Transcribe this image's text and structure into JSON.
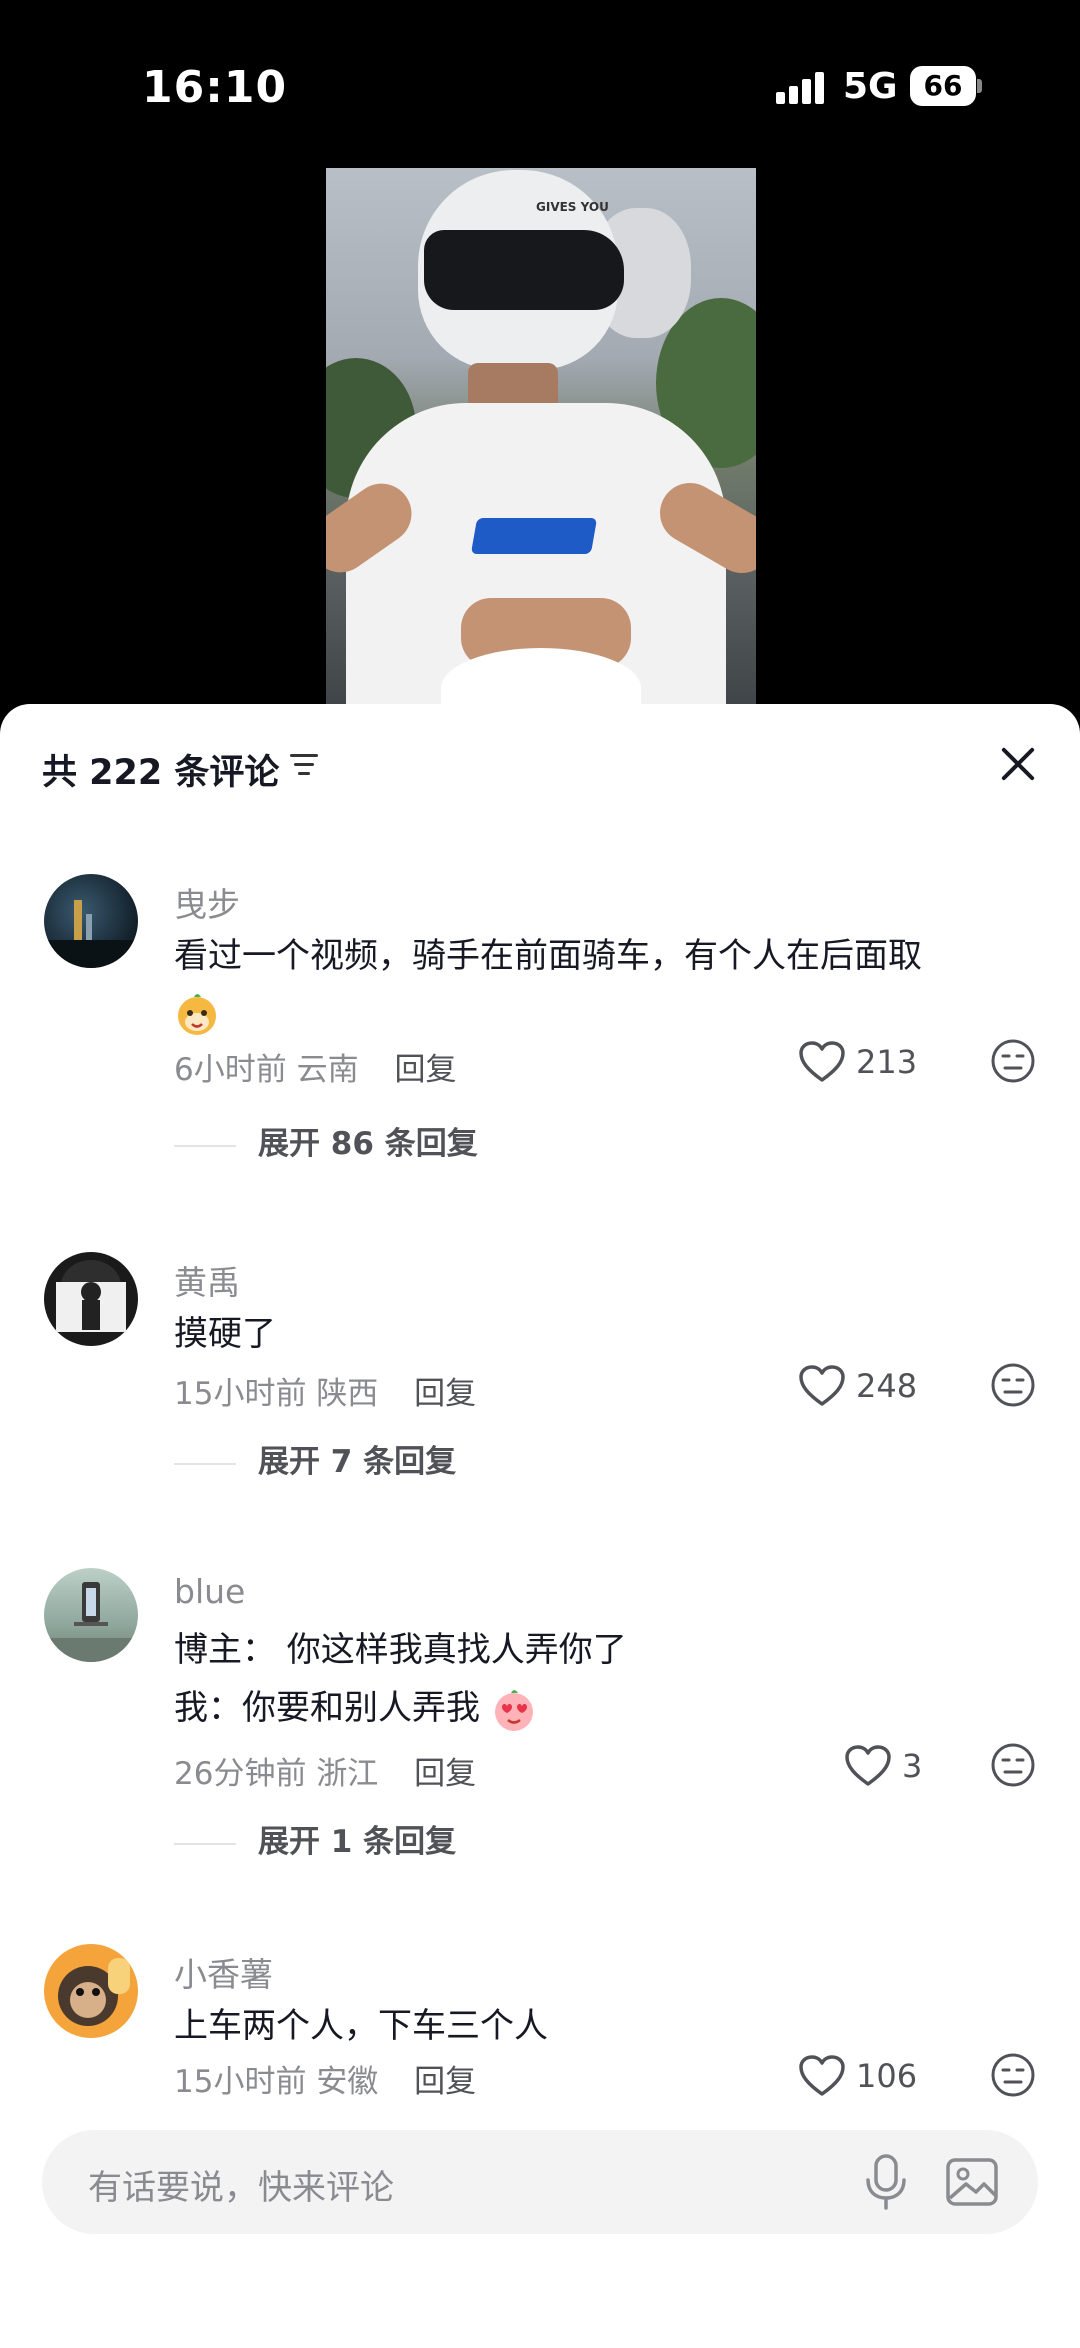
{
  "status_bar": {
    "time": "16:10",
    "network": "5G",
    "battery": "66"
  },
  "video": {
    "helmet_text": "GIVES YOU"
  },
  "comments_header": {
    "title": "共 222 条评论"
  },
  "comments": [
    {
      "username": "曳步",
      "lines": [
        "看过一个视频，骑手在前面骑车，有个人在后面取"
      ],
      "time": "6小时前",
      "location": "云南",
      "reply_label": "回复",
      "likes": "213",
      "expand": "展开 86 条回复"
    },
    {
      "username": "黄禹",
      "lines": [
        "摸硬了"
      ],
      "time": "15小时前",
      "location": "陕西",
      "reply_label": "回复",
      "likes": "248",
      "expand": "展开 7 条回复"
    },
    {
      "username": "blue",
      "lines": [
        "博主： 你这样我真找人弄你了",
        "我：你要和别人弄我"
      ],
      "time": "26分钟前",
      "location": "浙江",
      "reply_label": "回复",
      "likes": "3",
      "expand": "展开 1 条回复"
    },
    {
      "username": "小香薯",
      "lines": [
        "上车两个人，下车三个人"
      ],
      "time": "15小时前",
      "location": "安徽",
      "reply_label": "回复",
      "likes": "106",
      "expand": ""
    }
  ],
  "input": {
    "placeholder": "有话要说，快来评论"
  },
  "icons": [
    "filter-icon",
    "close-icon",
    "heart-icon",
    "dislike-face-icon",
    "mic-icon",
    "image-icon",
    "emoji-icon"
  ]
}
